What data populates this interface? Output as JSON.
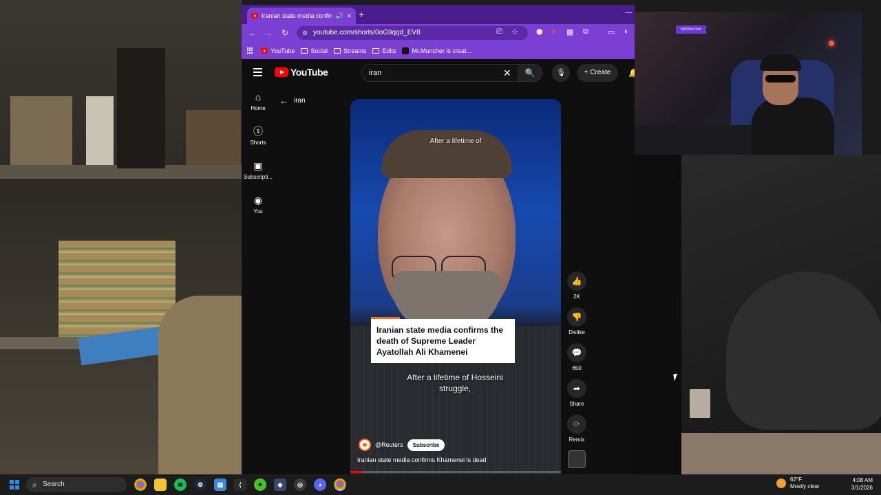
{
  "browser": {
    "tab_title": "Iranian state media confirm",
    "url": "youtube.com/shorts/0oG9qqd_EV8",
    "bookmarks": [
      "YouTube",
      "Social",
      "Streams",
      "Edits",
      "Mr.Muncher is creat..."
    ]
  },
  "youtube": {
    "logo": "YouTube",
    "search_value": "iran",
    "create_label": "Create",
    "back_query": "iran",
    "guide": [
      {
        "icon": "home-icon",
        "label": "Home"
      },
      {
        "icon": "shorts-icon",
        "label": "Shorts"
      },
      {
        "icon": "subscriptions-icon",
        "label": "Subscripti..."
      },
      {
        "icon": "you-icon",
        "label": "You"
      }
    ]
  },
  "short": {
    "caption_top": "After a lifetime of",
    "headline": "Iranian state media confirms the death of Supreme Leader Ayatollah Ali Khamenei",
    "subtitle": "After a lifetime of Hosseini struggle,",
    "channel": "@Reuters",
    "subscribe": "Subscribe",
    "title": "Iranian state media confirms Khamenei is dead",
    "progress_fraction": 0.06
  },
  "actions": {
    "like_count": "2K",
    "dislike": "Dislike",
    "comments_count": "650",
    "share": "Share",
    "remix": "Remix"
  },
  "webcam": {
    "neon_sign": "MrMuncher"
  },
  "taskbar": {
    "search": "Search",
    "weather_temp": "62°F",
    "weather_desc": "Mostly clear",
    "time": "4:08 AM",
    "date": "3/1/2026"
  },
  "colors": {
    "browser_frame": "#7b3fd3",
    "youtube_red": "#ff0000",
    "reuters_orange": "#ff6a1a"
  }
}
